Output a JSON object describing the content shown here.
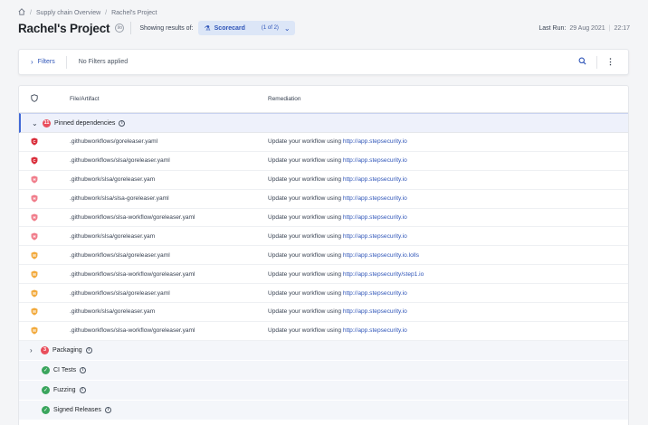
{
  "breadcrumb": {
    "home_icon": "home-icon",
    "items": [
      "Supply chain Overview",
      "Rachel's Project"
    ]
  },
  "header": {
    "title": "Rachel's Project",
    "title_badge": "i/o",
    "showing_label": "Showing results of:",
    "selector": {
      "icon": "scorecard-icon",
      "label": "Scorecard",
      "count": "(1 of 2)"
    },
    "last_run_label": "Last Run:",
    "last_run_date": "29 Aug 2021",
    "last_run_time": "22:17"
  },
  "filters": {
    "label": "Filters",
    "status": "No Filters applied"
  },
  "table": {
    "columns": [
      "File/Artifact",
      "Remediation"
    ],
    "groups": [
      {
        "name": "Pinned dependencies",
        "count": "11",
        "expanded": true
      },
      {
        "name": "Packaging",
        "count": "3",
        "expanded": false
      },
      {
        "name": "CI Tests",
        "status": "passed"
      },
      {
        "name": "Fuzzing",
        "status": "passed"
      },
      {
        "name": "Signed Releases",
        "status": "passed"
      }
    ],
    "rows": [
      {
        "severity": "critical",
        "file": ".githubworkflows/goreleaser.yaml",
        "text": "Update your workflow using",
        "link": "http://app.stepsecurity.io"
      },
      {
        "severity": "critical",
        "file": ".githubworkflows/slsa/goreleaser.yaml",
        "text": "Update your workflow using",
        "link": "http://app.stepsecurity.io"
      },
      {
        "severity": "high",
        "file": ".githubwork/slsa/goreleaser.yam",
        "text": "Update your workflow using",
        "link": "http://app.stepsecurity.io"
      },
      {
        "severity": "high",
        "file": ".githubwork/slsa/slsa-goreleaser.yaml",
        "text": "Update your workflow using",
        "link": "http://app.stepsecurity.io"
      },
      {
        "severity": "high",
        "file": ".githubworkflows/slsa-workflow/goreleaser.yaml",
        "text": "Update your workflow using",
        "link": "http://app.stepsecurity.io"
      },
      {
        "severity": "high",
        "file": ".githubwork/slsa/goreleaser.yam",
        "text": "Update your workflow using",
        "link": "http://app.stepsecurity.io"
      },
      {
        "severity": "medium",
        "file": ".githubworkflows/slsa/goreleaser.yaml",
        "text": "Update your workflow using",
        "link": "http://app.stepsecurity.io.lolls"
      },
      {
        "severity": "medium",
        "file": ".githubworkflows/slsa-workflow/goreleaser.yaml",
        "text": "Update your workflow using",
        "link": "http://app.stepsecurity/step1.io"
      },
      {
        "severity": "medium",
        "file": ".githubworkflows/slsa/goreleaser.yaml",
        "text": "Update your workflow using",
        "link": "http://app.stepsecurity.io"
      },
      {
        "severity": "medium",
        "file": ".githubwork/slsa/goreleaser.yam",
        "text": "Update your workflow using",
        "link": "http://app.stepsecurity.io"
      },
      {
        "severity": "medium",
        "file": ".githubworkflows/slsa-workflow/goreleaser.yaml",
        "text": "Update your workflow using",
        "link": "http://app.stepsecurity.io"
      }
    ]
  },
  "colors": {
    "critical": "#d92d3a",
    "high": "#f07c8a",
    "medium": "#f2a93b",
    "accent": "#2f55b8",
    "passed": "#3aa55d"
  }
}
